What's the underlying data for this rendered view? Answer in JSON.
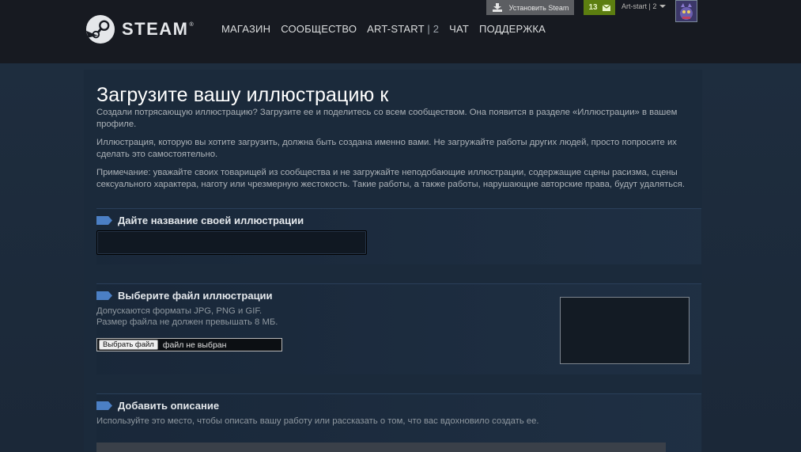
{
  "header": {
    "logo_text": "STEAM",
    "logo_tm": "®",
    "nav": [
      "МАГАЗИН",
      "СООБЩЕСТВО",
      "ART-START",
      "ЧАТ",
      "ПОДДЕРЖКА"
    ],
    "nav_sub": "| 2",
    "install_label": "Установить Steam",
    "notifications_count": "13",
    "account_name": "Art-start | 2"
  },
  "page": {
    "title": "Загрузите вашу иллюстрацию к",
    "intro": "Создали потрясающую иллюстрацию? Загрузите ее и поделитесь со всем сообществом. Она появится в разделе «Иллюстрации» в вашем профиле.",
    "ownership": "Иллюстрация, которую вы хотите загрузить, должна быть создана именно вами. Не загружайте работы других людей, просто попросите их сделать это самостоятельно.",
    "note": "Примечание: уважайте своих товарищей из сообщества и не загружайте неподобающие иллюстрации, содержащие сцены расизма, сцены сексуального характера, наготу или чрезмерную жестокость. Такие работы, а также работы, нарушающие авторские права, будут удаляться."
  },
  "sections": {
    "name": {
      "title": "Дайте название своей иллюстрации",
      "value": ""
    },
    "file": {
      "title": "Выберите файл иллюстрации",
      "hint_formats": "Допускаются форматы JPG, PNG и GIF.",
      "hint_size": "Размер файла не должен превышать 8 МБ.",
      "button_label": "Выбрать файл",
      "status": "файл не выбран"
    },
    "description": {
      "title": "Добавить описание",
      "hint": "Используйте это место, чтобы описать вашу работу или рассказать о том, что вас вдохновило создать ее."
    }
  },
  "colors": {
    "header_bg": "#171a21",
    "page_bg": "#1b2838",
    "accent_blue": "#4b7fc4",
    "notification_green": "#5c7e10"
  },
  "icons": [
    "steam-logo-icon",
    "download-icon",
    "envelope-icon",
    "caret-down-icon",
    "tag-icon"
  ]
}
